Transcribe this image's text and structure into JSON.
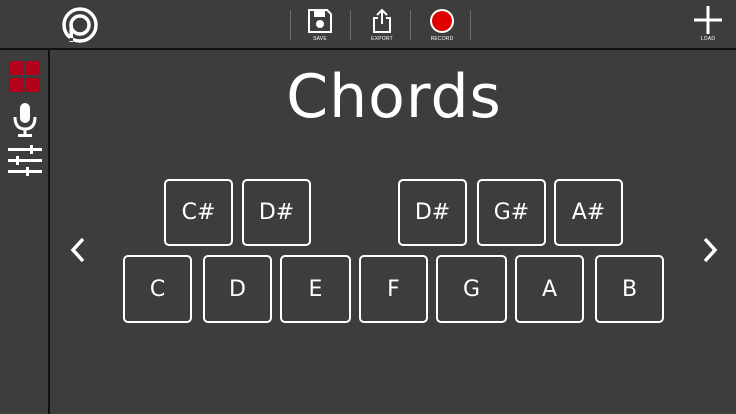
{
  "toolbar": {
    "save_label": "SAVE",
    "export_label": "EXPORT",
    "record_label": "RECORD",
    "load_label": "LOAD"
  },
  "main": {
    "title": "Chords"
  },
  "keys": {
    "sharps": [
      "C#",
      "D#",
      "D#",
      "G#",
      "A#"
    ],
    "naturals": [
      "C",
      "D",
      "E",
      "F",
      "G",
      "A",
      "B"
    ]
  },
  "colors": {
    "background": "#3e3d3d",
    "pads_accent": "#b3001b",
    "record": "#e00000"
  }
}
